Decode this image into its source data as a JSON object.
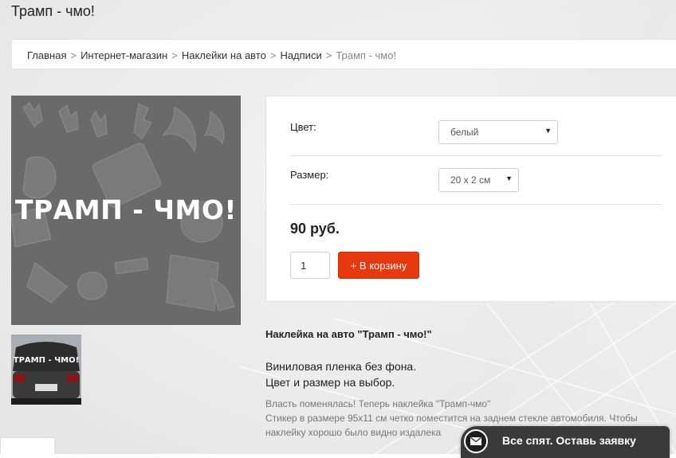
{
  "page": {
    "title": "Трамп - чмо!"
  },
  "breadcrumb": {
    "items": [
      "Главная",
      "Интернет-магазин",
      "Наклейки на авто",
      "Надписи"
    ],
    "separator": ">",
    "current": "Трамп - чмо!"
  },
  "product_image": {
    "text": "ТРАМП - ЧМО!",
    "thumb_text": "ТРАМП - ЧМО!",
    "background_color": "#6a6a6a"
  },
  "options": {
    "color_label": "Цвет:",
    "color_value": "белый",
    "size_label": "Размер:",
    "size_value": "20 x 2 см",
    "price": "90 руб.",
    "quantity": "1",
    "cart_button": "+ В корзину",
    "accent_color": "#e8380d"
  },
  "description": {
    "title": "Наклейка на авто \"Трамп - чмо!\"",
    "line1": "Виниловая пленка без фона.",
    "line2": "Цвет и размер на выбор.",
    "line3": "Власть поменялась! Теперь наклейка \"Трамп-чмо\"",
    "line4": "Стикер в размере 95x11 см четко поместится на заднем стекле автомобиля. Чтобы",
    "line5": "наклейку хорошо было видно издалека"
  },
  "callback": {
    "label": "Все спят. Оставь заявку",
    "icon": "envelope-icon"
  }
}
